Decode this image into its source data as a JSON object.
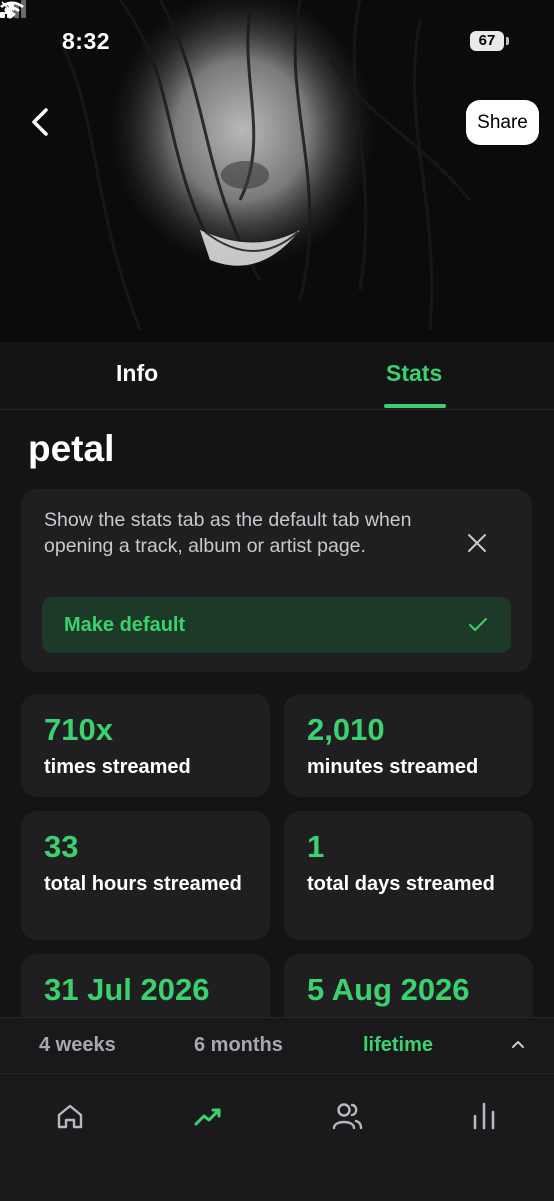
{
  "status_bar": {
    "time": "8:32",
    "battery": "67",
    "icons": [
      "bell-slash-icon",
      "signal-icon",
      "wifi-icon",
      "battery-icon"
    ]
  },
  "header": {
    "share_label": "Share",
    "back_icon": "chevron-left-icon"
  },
  "tabs": [
    {
      "label": "Info",
      "active": false
    },
    {
      "label": "Stats",
      "active": true
    }
  ],
  "track": {
    "title": "petal"
  },
  "notice": {
    "text": "Show the stats tab as the default tab when opening a track, album or artist page.",
    "button_label": "Make default"
  },
  "stats": [
    {
      "value": "710x",
      "label": "times streamed"
    },
    {
      "value": "2,010",
      "label": "minutes streamed"
    },
    {
      "value": "33",
      "label": "total hours streamed"
    },
    {
      "value": "1",
      "label": "total days streamed"
    },
    {
      "value": "31 Jul 2026",
      "label": ""
    },
    {
      "value": "5 Aug 2026",
      "label": ""
    }
  ],
  "range": {
    "options": [
      "4 weeks",
      "6 months",
      "lifetime"
    ],
    "selected": "lifetime"
  },
  "bottom_nav": {
    "items": [
      "home-icon",
      "trending-icon",
      "friends-icon",
      "charts-icon"
    ],
    "active": "trending-icon"
  },
  "colors": {
    "accent": "#3bd16f",
    "background": "#141416",
    "card": "#1f1f22"
  }
}
